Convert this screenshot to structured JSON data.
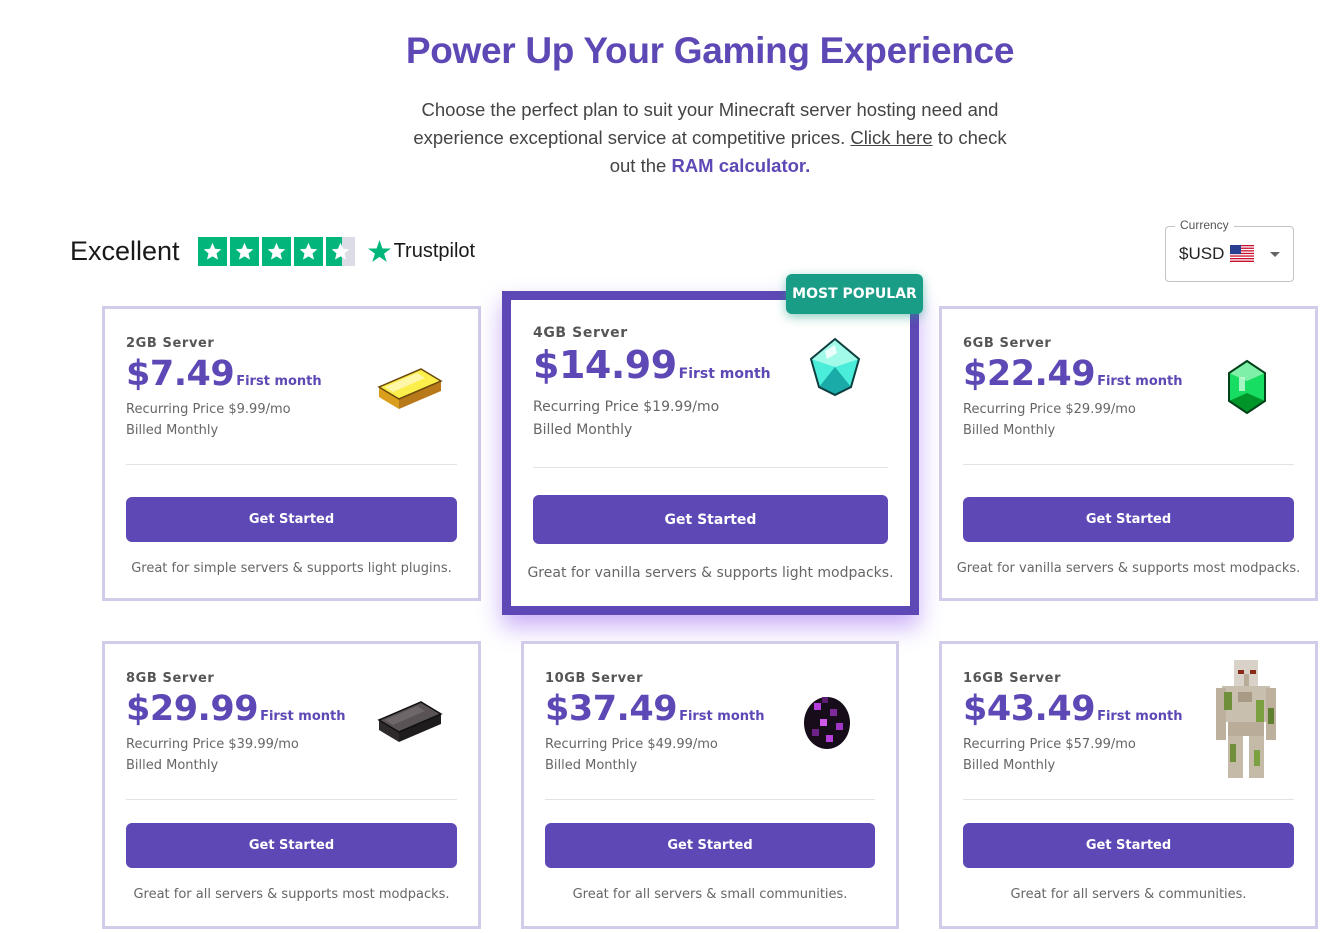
{
  "header": {
    "title": "Power Up Your Gaming Experience",
    "subtitle_before": "Choose the perfect plan to suit your Minecraft server hosting need and experience exceptional service at competitive prices.",
    "subtitle_link": "Click here",
    "subtitle_middle": "to check out the",
    "subtitle_ram_link": "RAM calculator."
  },
  "trustpilot": {
    "rating_word": "Excellent",
    "stars": 4.5,
    "brand": "Trustpilot"
  },
  "currency": {
    "label": "Currency",
    "value": "$USD",
    "flag_icon": "us-flag-icon"
  },
  "badge": "MOST POPULAR",
  "plans": [
    {
      "name": "2GB Server",
      "price": "$7.49",
      "first_label": "First month",
      "recurring": "Recurring Price $9.99/mo",
      "billed": "Billed Monthly",
      "button": "Get Started",
      "description": "Great for simple servers & supports light plugins.",
      "icon": "gold-ingot-icon"
    },
    {
      "name": "4GB Server",
      "price": "$14.99",
      "first_label": "First month",
      "recurring": "Recurring Price $19.99/mo",
      "billed": "Billed Monthly",
      "button": "Get Started",
      "description": "Great for vanilla servers & supports light modpacks.",
      "icon": "diamond-icon"
    },
    {
      "name": "6GB Server",
      "price": "$22.49",
      "first_label": "First month",
      "recurring": "Recurring Price $29.99/mo",
      "billed": "Billed Monthly",
      "button": "Get Started",
      "description": "Great for vanilla servers & supports most modpacks.",
      "icon": "emerald-icon"
    },
    {
      "name": "8GB Server",
      "price": "$29.99",
      "first_label": "First month",
      "recurring": "Recurring Price $39.99/mo",
      "billed": "Billed Monthly",
      "button": "Get Started",
      "description": "Great for all servers & supports most modpacks.",
      "icon": "netherite-ingot-icon"
    },
    {
      "name": "10GB Server",
      "price": "$37.49",
      "first_label": "First month",
      "recurring": "Recurring Price $49.99/mo",
      "billed": "Billed Monthly",
      "button": "Get Started",
      "description": "Great for all servers & small communities.",
      "icon": "ender-egg-icon"
    },
    {
      "name": "16GB Server",
      "price": "$43.49",
      "first_label": "First month",
      "recurring": "Recurring Price $57.99/mo",
      "billed": "Billed Monthly",
      "button": "Get Started",
      "description": "Great for all servers & communities.",
      "icon": "iron-golem-icon"
    }
  ],
  "colors": {
    "brand_purple": "#5e48b5",
    "badge_teal": "#1a9d86",
    "trustpilot_green": "#00b67a",
    "card_border": "#d2cbea"
  }
}
